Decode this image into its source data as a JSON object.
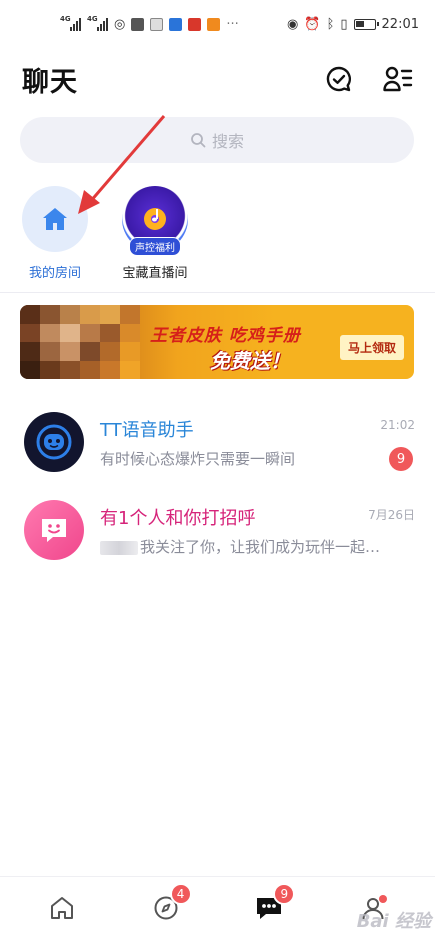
{
  "status_bar": {
    "network_left": "4G",
    "network_right": "4G",
    "time": "22:01"
  },
  "header": {
    "title": "聊天",
    "icons": [
      "chat-check-icon",
      "contacts-icon"
    ]
  },
  "search": {
    "placeholder": "搜索"
  },
  "rooms": [
    {
      "label": "我的房间",
      "icon": "home-icon"
    },
    {
      "label": "宝藏直播间",
      "tag": "声控福利",
      "icon": "music-disc-icon"
    }
  ],
  "banner": {
    "line1": "王者皮肤 吃鸡手册",
    "line2": "免费送！",
    "button": "马上领取"
  },
  "chats": [
    {
      "name": "TT语音助手",
      "preview": "有时候心态爆炸只需要一瞬间",
      "time": "21:02",
      "unread": "9"
    },
    {
      "name": "有1个人和你打招呼",
      "preview": "我关注了你，让我们成为玩伴一起…",
      "time": "7月26日"
    }
  ],
  "tabbar": {
    "tabs": [
      {
        "name": "home-tab",
        "icon": "home-outline-icon"
      },
      {
        "name": "discover-tab",
        "icon": "compass-icon",
        "badge": "4"
      },
      {
        "name": "chat-tab",
        "icon": "chat-bubble-icon",
        "badge": "9"
      },
      {
        "name": "profile-tab",
        "icon": "person-icon"
      }
    ],
    "watermark": "Bai 经验"
  }
}
